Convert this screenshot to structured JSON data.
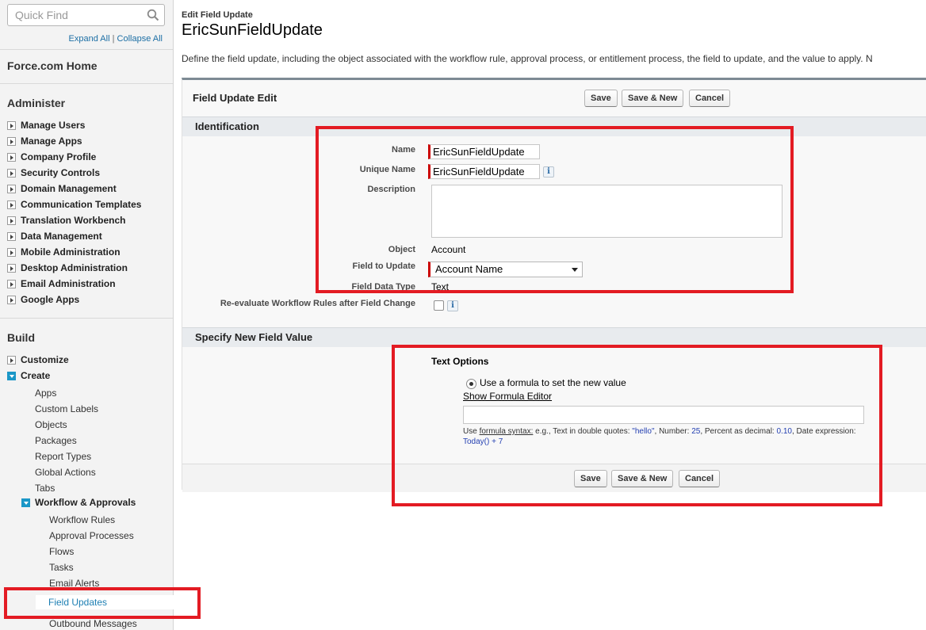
{
  "sidebar": {
    "search_placeholder": "Quick Find",
    "expand_all": "Expand All",
    "separator": "|",
    "collapse_all": "Collapse All",
    "home": "Force.com Home",
    "administer_heading": "Administer",
    "administer_items": [
      "Manage Users",
      "Manage Apps",
      "Company Profile",
      "Security Controls",
      "Domain Management",
      "Communication Templates",
      "Translation Workbench",
      "Data Management",
      "Mobile Administration",
      "Desktop Administration",
      "Email Administration",
      "Google Apps"
    ],
    "build_heading": "Build",
    "customize": "Customize",
    "create": "Create",
    "create_items": [
      "Apps",
      "Custom Labels",
      "Objects",
      "Packages",
      "Report Types",
      "Global Actions",
      "Tabs"
    ],
    "workflow": "Workflow & Approvals",
    "workflow_items": [
      "Workflow Rules",
      "Approval Processes",
      "Flows",
      "Tasks",
      "Email Alerts",
      "Field Updates",
      "Outbound Messages"
    ]
  },
  "header": {
    "breadcrumb": "Edit Field Update",
    "title": "EricSunFieldUpdate",
    "description": "Define the field update, including the object associated with the workflow rule, approval process, or entitlement process, the field to update, and the value to apply. N"
  },
  "panel": {
    "title": "Field Update Edit",
    "save": "Save",
    "save_new": "Save & New",
    "cancel": "Cancel"
  },
  "identification": {
    "heading": "Identification",
    "name_label": "Name",
    "name_value": "EricSunFieldUpdate",
    "unique_label": "Unique Name",
    "unique_value": "EricSunFieldUpdate",
    "description_label": "Description",
    "object_label": "Object",
    "object_value": "Account",
    "field_label": "Field to Update",
    "field_value": "Account Name",
    "datatype_label": "Field Data Type",
    "datatype_value": "Text",
    "reevaluate_label": "Re-evaluate Workflow Rules after Field Change",
    "info_glyph": "i"
  },
  "new_value": {
    "heading": "Specify New Field Value",
    "text_options": "Text Options",
    "radio_label": "Use a formula to set the new value",
    "formula_link": "Show Formula Editor",
    "hint_use": "Use ",
    "hint_syntax": "formula syntax:",
    "hint_text1": " e.g., Text in double quotes: ",
    "hint_hello": "\"hello\"",
    "hint_text2": ", Number: ",
    "hint_num": "25",
    "hint_text3": ", Percent as decimal: ",
    "hint_pct": "0.10",
    "hint_text4": ", Date expression: ",
    "hint_date": "Today() + 7"
  },
  "colors": {
    "highlight": "#e31b23",
    "accent": "#1b97c7",
    "required": "#cc0000"
  }
}
